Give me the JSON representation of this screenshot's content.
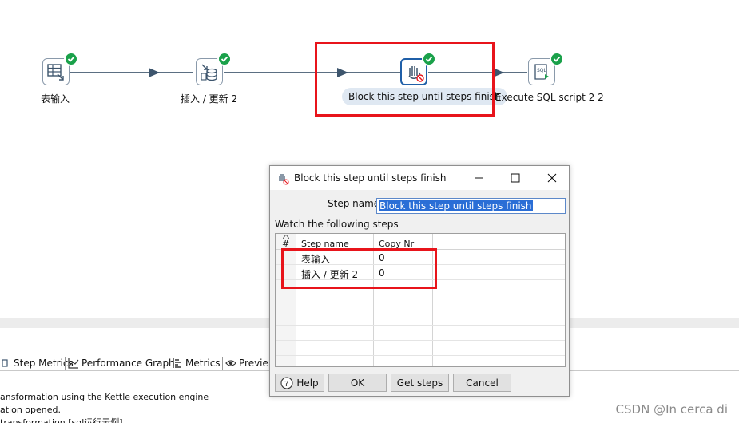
{
  "canvas": {
    "steps": [
      {
        "label": "表输入",
        "icon": "table-input-icon",
        "status": "success"
      },
      {
        "label": "插入 / 更新 2",
        "icon": "insert-update-icon",
        "status": "success"
      },
      {
        "label": "Block this step until steps finish",
        "icon": "block-step-icon",
        "status": "success",
        "selected": true
      },
      {
        "label": "Execute SQL script 2 2",
        "icon": "sql-script-icon",
        "status": "success"
      }
    ],
    "accent_hop": "#3d556d",
    "highlight_color": "#e8141b"
  },
  "dialog": {
    "title": "Block this step until steps finish",
    "step_name_label": "Step name",
    "step_name_value": "Block this step until steps finish",
    "watch_label": "Watch the following steps",
    "columns": [
      "#",
      "Step name",
      "Copy Nr"
    ],
    "rows": [
      {
        "num": "",
        "step": "表输入",
        "copy": "0"
      },
      {
        "num": "",
        "step": "插入 / 更新 2",
        "copy": "0"
      }
    ],
    "buttons": {
      "help": "Help",
      "ok": "OK",
      "get_steps": "Get steps",
      "cancel": "Cancel"
    }
  },
  "bottom": {
    "tabs": [
      "Step Metrics",
      "Performance Graph",
      "Metrics",
      "Previe"
    ],
    "log": [
      "ansformation using the Kettle execution engine",
      "ation opened.",
      "transformation [sql运行示例]"
    ]
  },
  "watermark": "CSDN @In cerca di"
}
